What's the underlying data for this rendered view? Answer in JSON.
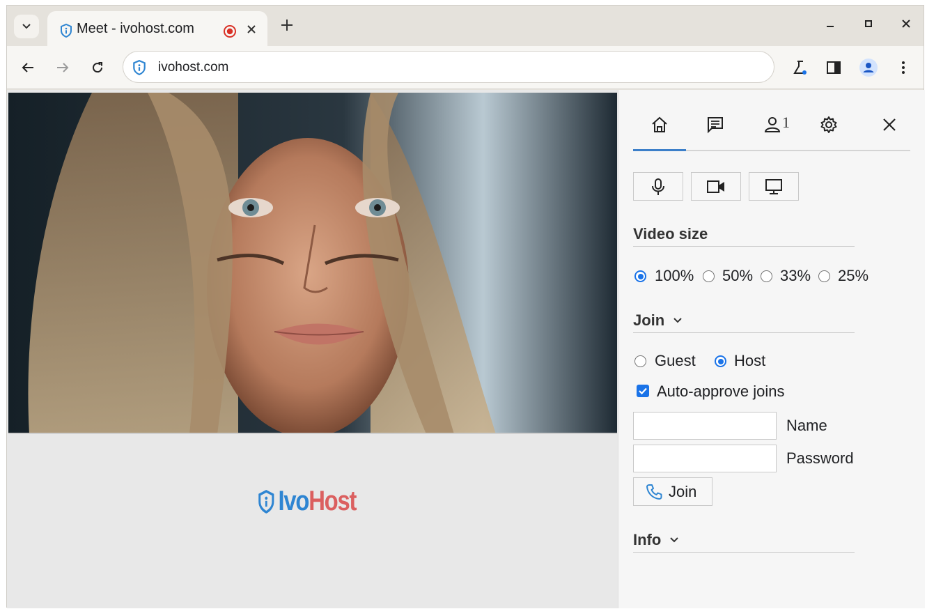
{
  "browser": {
    "tab_title": "Meet - ivohost.com",
    "url": "ivohost.com"
  },
  "brand": {
    "part1": "Ivo",
    "part2": "Host"
  },
  "panel": {
    "participants_badge": "1",
    "video_size": {
      "title": "Video size",
      "options": [
        "100%",
        "50%",
        "33%",
        "25%"
      ],
      "selected": "100%"
    },
    "join": {
      "title": "Join",
      "roles": [
        "Guest",
        "Host"
      ],
      "selected_role": "Host",
      "auto_approve_label": "Auto-approve joins",
      "auto_approve_checked": true,
      "name_label": "Name",
      "name_value": "",
      "password_label": "Password",
      "password_value": "",
      "join_button": "Join"
    },
    "info": {
      "title": "Info"
    }
  },
  "colors": {
    "accent": "#1a73e8",
    "brand_blue": "#2e85d2",
    "brand_red": "#db5f5f",
    "recording": "#d93025"
  }
}
